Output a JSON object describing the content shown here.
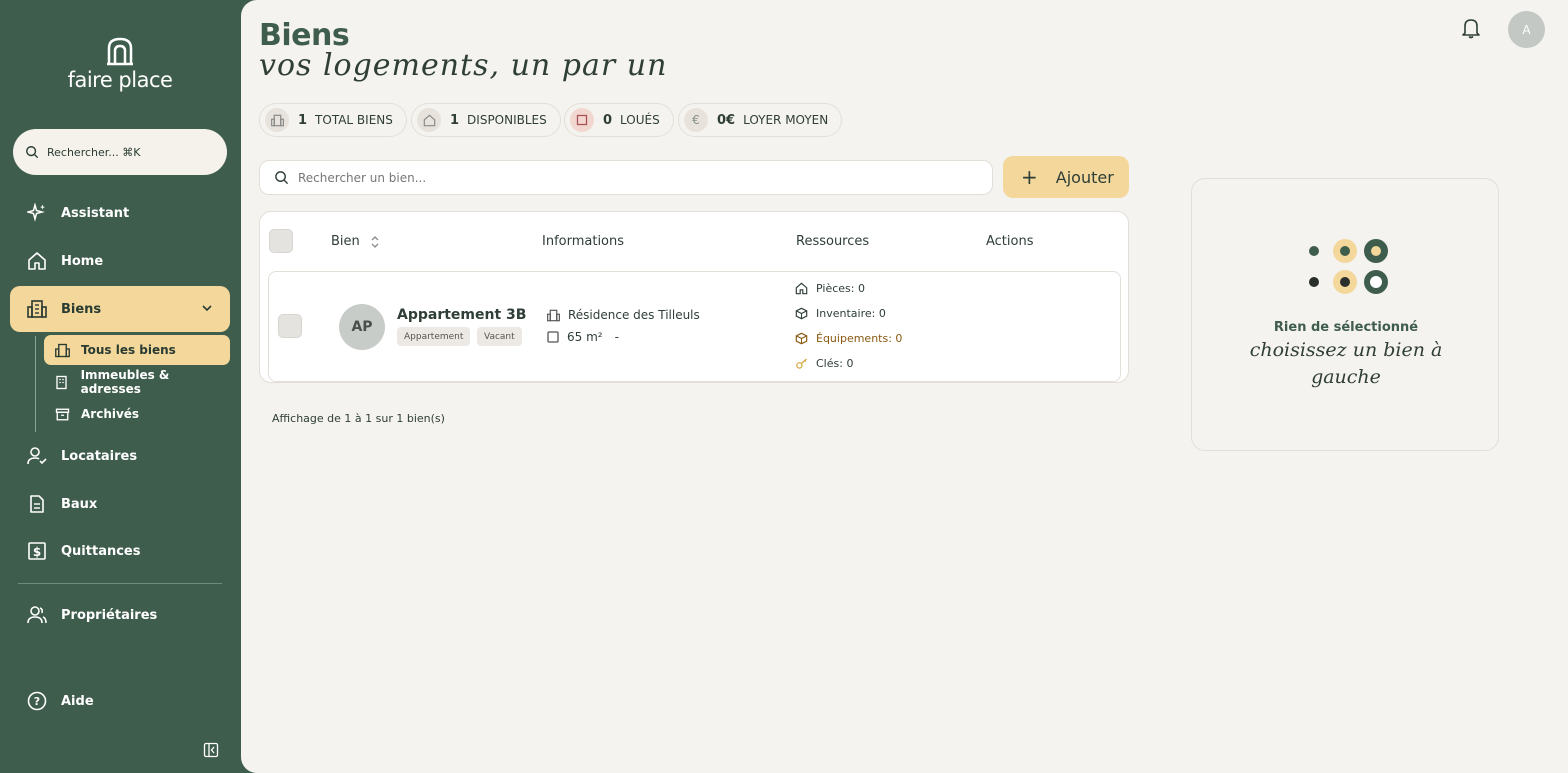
{
  "sidebar": {
    "logo_text": "faire place",
    "search_placeholder": "Rechercher... ⌘K",
    "items": [
      {
        "label": "Assistant"
      },
      {
        "label": "Home"
      },
      {
        "label": "Biens"
      },
      {
        "label": "Locataires"
      },
      {
        "label": "Baux"
      },
      {
        "label": "Quittances"
      },
      {
        "label": "Propriétaires"
      },
      {
        "label": "Aide"
      }
    ],
    "sub_items": [
      {
        "label": "Tous les biens"
      },
      {
        "label": "Immeubles & adresses"
      },
      {
        "label": "Archivés"
      }
    ]
  },
  "header": {
    "title": "Biens",
    "subtitle": "vos logements, un par un",
    "avatar_initial": "A"
  },
  "stats": [
    {
      "value": "1",
      "label": "TOTAL BIENS"
    },
    {
      "value": "1",
      "label": "DISPONIBLES"
    },
    {
      "value": "0",
      "label": "LOUÉS"
    },
    {
      "value": "0€",
      "label": "LOYER MOYEN",
      "icon": "€"
    }
  ],
  "search": {
    "placeholder": "Rechercher un bien..."
  },
  "add_button": {
    "label": "Ajouter"
  },
  "table": {
    "headers": {
      "bien": "Bien",
      "informations": "Informations",
      "ressources": "Ressources",
      "actions": "Actions"
    },
    "rows": [
      {
        "initials": "AP",
        "name": "Appartement 3B",
        "tags": [
          "Appartement",
          "Vacant"
        ],
        "residence": "Résidence des Tilleuls",
        "surface": "65 m²",
        "floor": "-",
        "pieces": "Pièces: 0",
        "inventaire": "Inventaire: 0",
        "equipements": "Équipements: 0",
        "cles": "Clés: 0"
      }
    ]
  },
  "pagination": "Affichage de 1 à 1 sur 1 bien(s)",
  "detail": {
    "title": "Rien de sélectionné",
    "subtitle": "choisissez un bien à gauche"
  },
  "colors": {
    "sidebar": "#3f5d4d",
    "accent": "#f3d79b",
    "background": "#f5f3ef"
  }
}
